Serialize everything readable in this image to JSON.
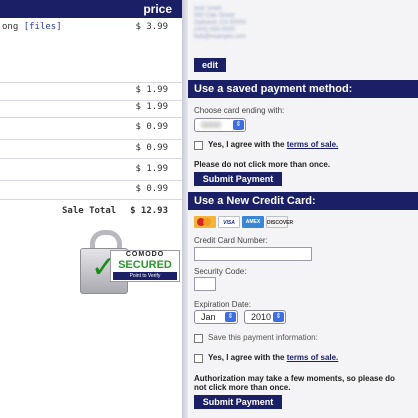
{
  "cart": {
    "header": "price",
    "first_item": {
      "label_fragment": "ong",
      "files_link": "[files]",
      "price": "$ 3.99"
    },
    "item_prices": [
      "$ 1.99",
      "$ 1.99",
      "$ 0.99",
      "$ 0.99",
      "$ 1.99",
      "$ 0.99"
    ],
    "sale_total_label": "Sale Total",
    "sale_total_value": "$ 12.93"
  },
  "seal": {
    "line1": "COMODO",
    "line2": "SECURED",
    "line3": "Point to Verify"
  },
  "billing": {
    "address_lines": [
      "Bob Smith",
      "000 Oak Street",
      "Oakland, CA 00000",
      "(000) 000-0000",
      "bob@example.com"
    ],
    "edit_label": "edit"
  },
  "saved_payment": {
    "heading": "Use a saved payment method:",
    "choose_label": "Choose card ending with:",
    "card_ending": "0000",
    "terms_prefix": "Yes, I agree with the ",
    "terms_link": "terms of sale.",
    "warning": "Please do not click more than once.",
    "submit_label": "Submit Payment"
  },
  "new_card": {
    "heading": "Use a New Credit Card:",
    "card_brands": [
      "MasterCard",
      "VISA",
      "AMEX",
      "DISCOVER"
    ],
    "card_number_label": "Credit Card Number:",
    "security_code_label": "Security Code:",
    "expiration_label": "Expiration Date:",
    "exp_month": "Jan",
    "exp_year": "2010",
    "save_info_label": "Save this payment information:",
    "terms_prefix": "Yes, I agree with the ",
    "terms_link": "terms of sale.",
    "auth_note": "Authorization may take a few moments, so please do not click more than once.",
    "submit_label": "Submit Payment"
  },
  "colors": {
    "navy": "#1b1f66",
    "select_arrow": "#3f6ee0",
    "secured_green": "#2c9a2c"
  }
}
